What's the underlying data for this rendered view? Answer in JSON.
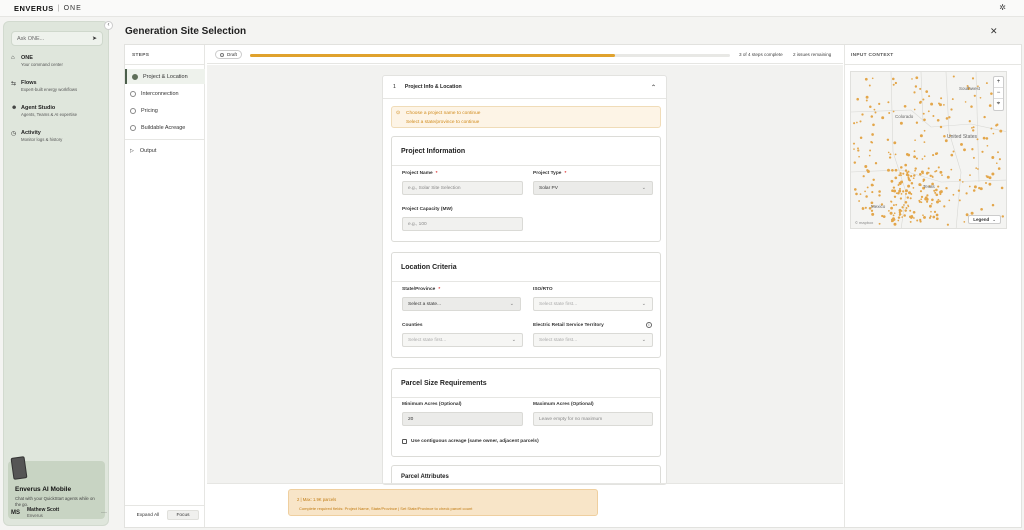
{
  "topbar": {
    "brand": "ENVERUS",
    "separator": "|",
    "product": "ONE"
  },
  "sidebar": {
    "ask_placeholder": "Ask ONE...",
    "items": [
      {
        "title": "ONE",
        "subtitle": "Your command center"
      },
      {
        "title": "Flows",
        "subtitle": "Expert-built energy workflows"
      },
      {
        "title": "Agent Studio",
        "subtitle": "Agents, Teams & AI expertise"
      },
      {
        "title": "Activity",
        "subtitle": "Monitor logs & history"
      }
    ],
    "mobile": {
      "title": "Enverus AI Mobile",
      "subtitle": "Chat with your QuickStart agents while on the go."
    },
    "user": {
      "initials": "MS",
      "name": "Mathew Scott",
      "org": "Enverus"
    }
  },
  "page": {
    "title": "Generation Site Selection"
  },
  "steps": {
    "heading": "STEPS",
    "items": [
      "Project & Location",
      "Interconnection",
      "Pricing",
      "Buildable Acreage"
    ],
    "output": "Output",
    "expand_all": "Expand All",
    "focus": "Focus"
  },
  "progress": {
    "status": "Draft",
    "fraction": 0.76,
    "steps_text": "3 of 4 steps complete",
    "issues_text": "2 issues remaining"
  },
  "section": {
    "number": "1",
    "title": "Project Info & Location",
    "warnings": [
      "Choose a project name to continue",
      "Select a state/province to continue"
    ]
  },
  "project_info": {
    "title": "Project Information",
    "name_label": "Project Name",
    "name_placeholder": "e.g., Solar Site Selection",
    "type_label": "Project Type",
    "type_value": "Solar PV",
    "capacity_label": "Project Capacity (MW)",
    "capacity_placeholder": "e.g., 100",
    "required_mark": "*"
  },
  "location": {
    "title": "Location Criteria",
    "state_label": "State/Province",
    "state_value": "Select a state...",
    "iso_label": "ISO/RTO",
    "iso_value": "Select state first...",
    "counties_label": "Counties",
    "counties_value": "Select state first...",
    "ers_label": "Electric Retail Service Territory",
    "ers_value": "Select state first..."
  },
  "parcel": {
    "title": "Parcel Size Requirements",
    "min_label": "Minimum Acres (Optional)",
    "min_value": "20",
    "max_label": "Maximum Acres (Optional)",
    "max_placeholder": "Leave empty for no maximum",
    "contiguous_label": "Use contiguous acreage (same owner, adjacent parcels)"
  },
  "attributes": {
    "title": "Parcel Attributes"
  },
  "footer": {
    "line1": "2 | Max: 1.9K parcels",
    "line2": "Complete required fields: Project Name, State/Province | Set State/Province to check parcel count"
  },
  "context": {
    "heading": "INPUT CONTEXT",
    "legend": "Legend",
    "map_labels": [
      "United States",
      "Southwest",
      "Colorado",
      "Texas",
      "Mexico"
    ],
    "attribution": "© mapbox"
  }
}
